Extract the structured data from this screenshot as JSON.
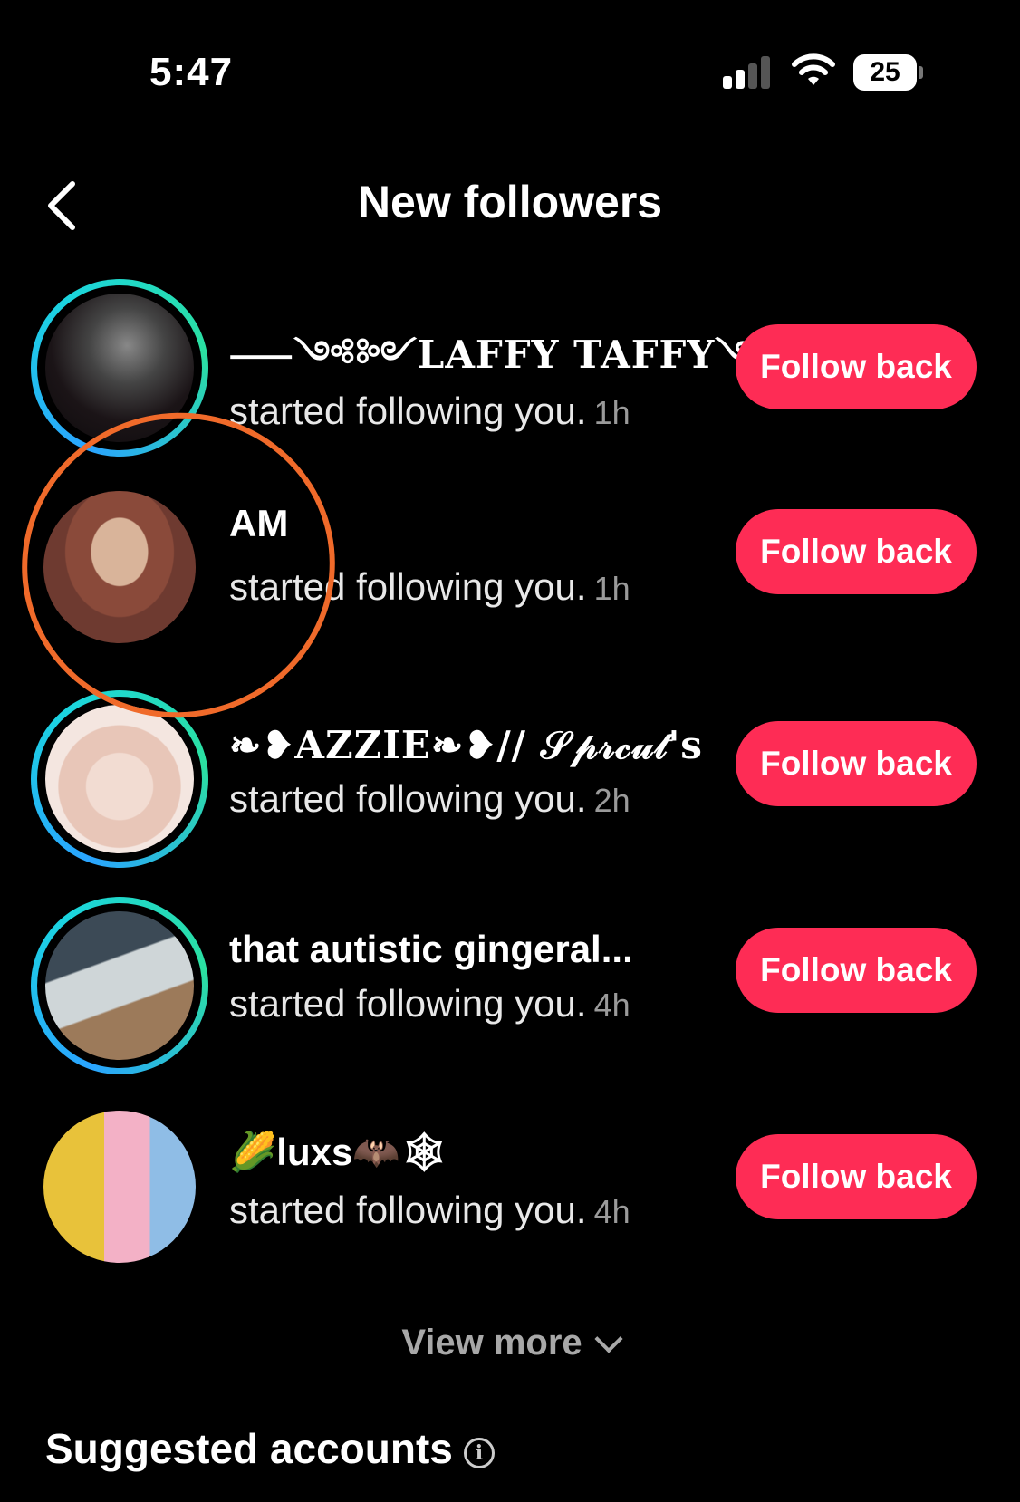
{
  "status_bar": {
    "time": "5:47",
    "battery": "25"
  },
  "header": {
    "title": "New followers"
  },
  "followers": [
    {
      "name": "⸺༺༻LAFFY TAFFY༺༻⸺",
      "activity": "started following you.",
      "time": "1h",
      "button": "Follow back"
    },
    {
      "name": "AM",
      "activity": "started following you.",
      "time": "1h",
      "button": "Follow back"
    },
    {
      "name": "❧❥AZZIE❧❥// 𝒮𝓅𝓇𝒸𝓊𝓉's",
      "activity": "started following you.",
      "time": "2h",
      "button": "Follow back"
    },
    {
      "name": "that autistic gingeral...",
      "activity": "started following you.",
      "time": "4h",
      "button": "Follow back"
    },
    {
      "name": "🌽luxs🦇🕸",
      "activity": "started following you.",
      "time": "4h",
      "button": "Follow back"
    }
  ],
  "view_more": "View more",
  "suggested": {
    "title": "Suggested accounts"
  }
}
